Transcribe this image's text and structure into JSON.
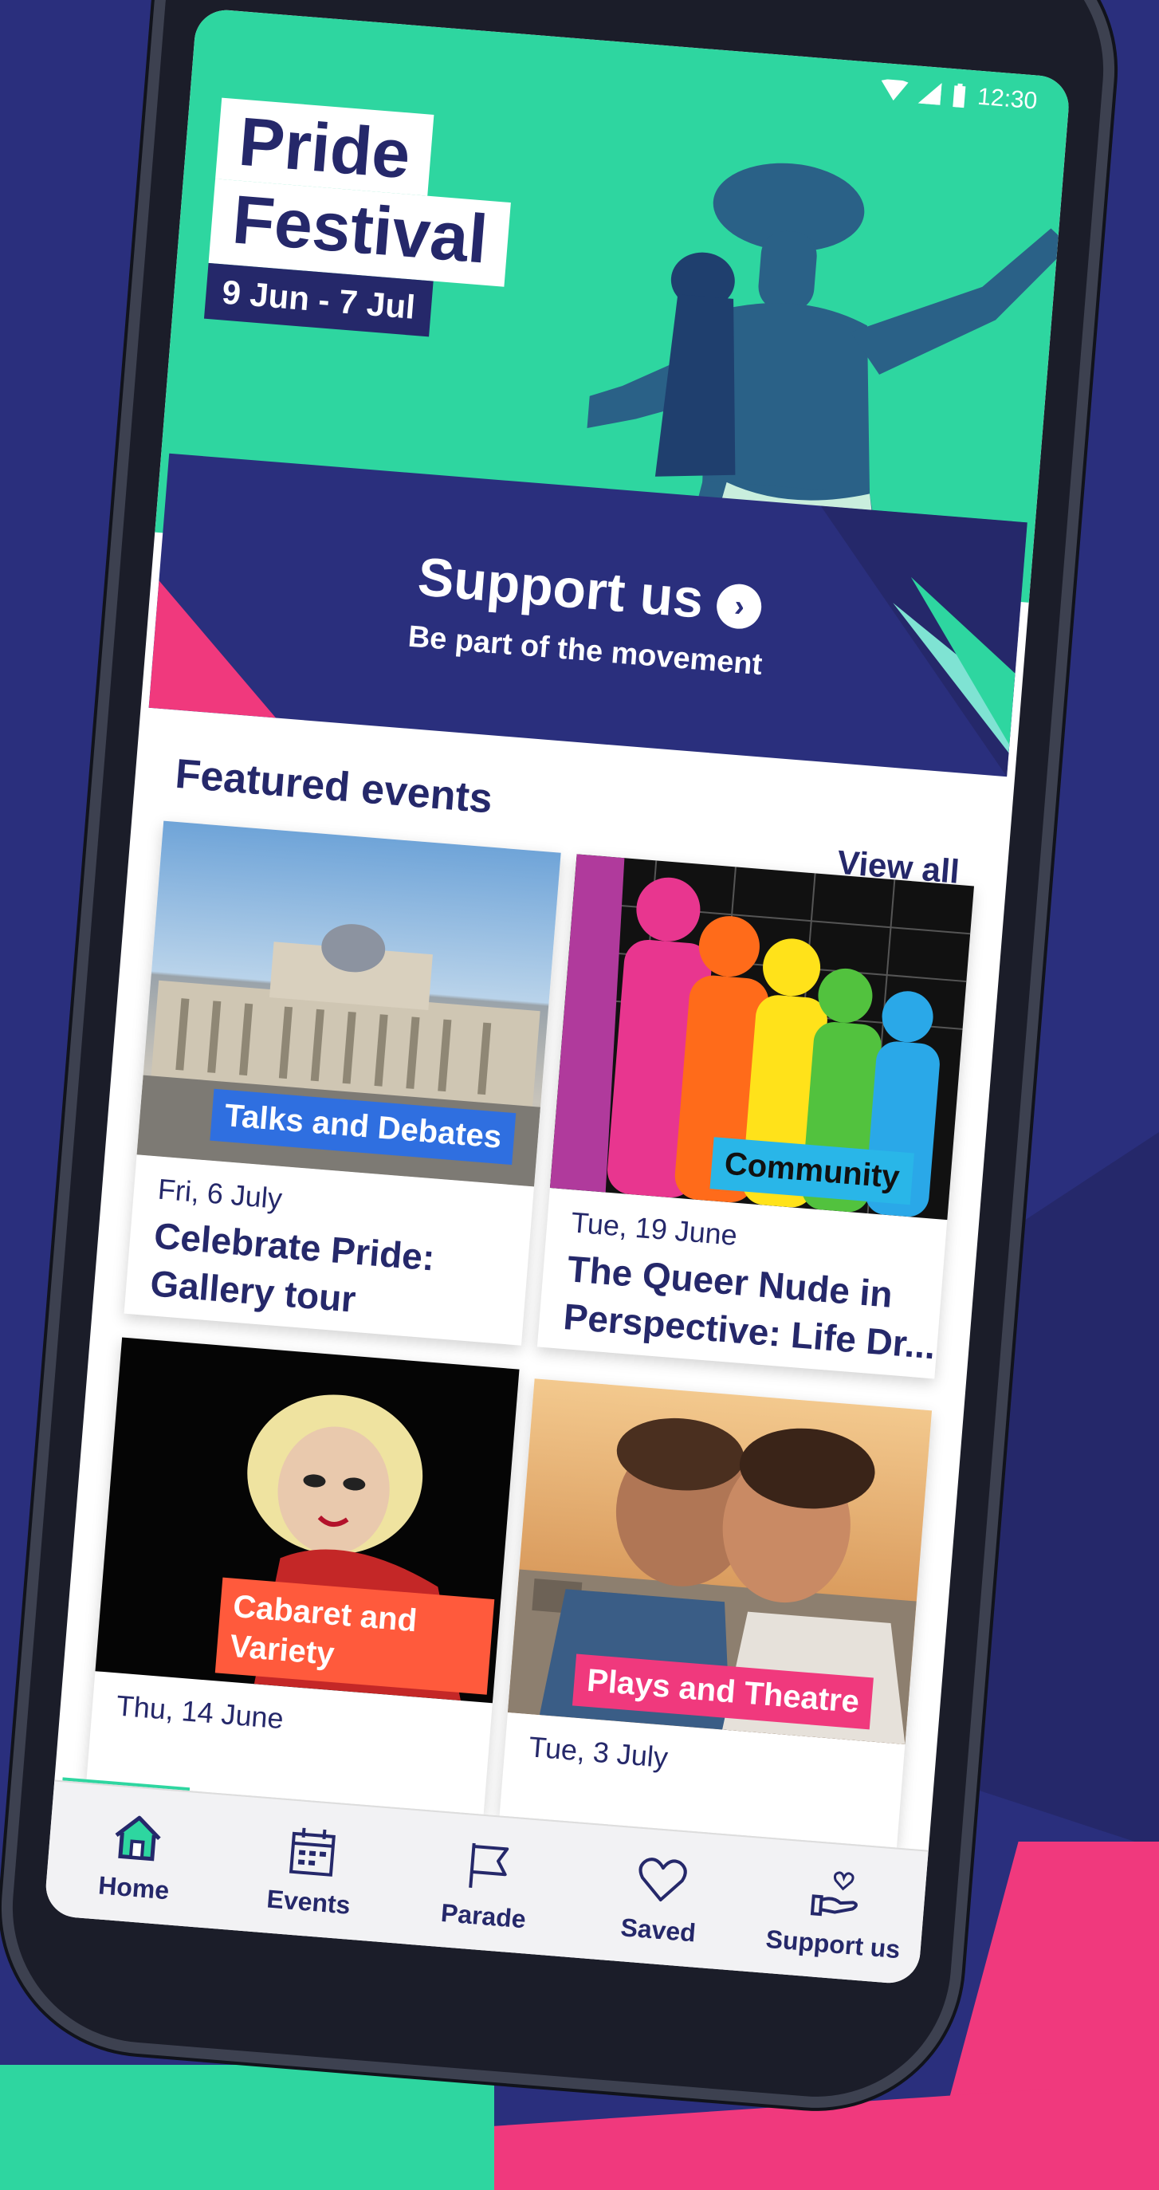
{
  "status_bar": {
    "time": "12:30",
    "icons": [
      "wifi-icon",
      "signal-icon",
      "battery-icon"
    ]
  },
  "hero": {
    "title_line1": "Pride",
    "title_line2": "Festival",
    "dates": "9 Jun - 7 Jul"
  },
  "support_banner": {
    "title": "Support us",
    "subtitle": "Be part of the movement"
  },
  "featured": {
    "heading": "Featured events",
    "view_all": "View all",
    "cards": [
      {
        "tag": "Talks and Debates",
        "tag_color": "#2f6fe0",
        "date": "Fri, 6 July",
        "title": "Celebrate Pride: Gallery tour"
      },
      {
        "tag": "Community",
        "tag_color": "#29b6e8",
        "date": "Tue, 19 June",
        "title": "The Queer Nude in Perspective: Life Dr..."
      },
      {
        "tag": "Cabaret and Variety",
        "tag_color": "#ff5a3c",
        "date": "Thu, 14 June",
        "title": ""
      },
      {
        "tag": "Plays and Theatre",
        "tag_color": "#f0397d",
        "date": "Tue, 3 July",
        "title": ""
      }
    ]
  },
  "bottom_nav": {
    "items": [
      {
        "label": "Home",
        "icon": "home-icon",
        "active": true
      },
      {
        "label": "Events",
        "icon": "calendar-icon"
      },
      {
        "label": "Parade",
        "icon": "flag-icon"
      },
      {
        "label": "Saved",
        "icon": "heart-icon"
      },
      {
        "label": "Support us",
        "icon": "hand-heart-icon"
      }
    ]
  },
  "colors": {
    "navy": "#25286a",
    "teal": "#2ed6a0",
    "pink": "#f0397d"
  }
}
